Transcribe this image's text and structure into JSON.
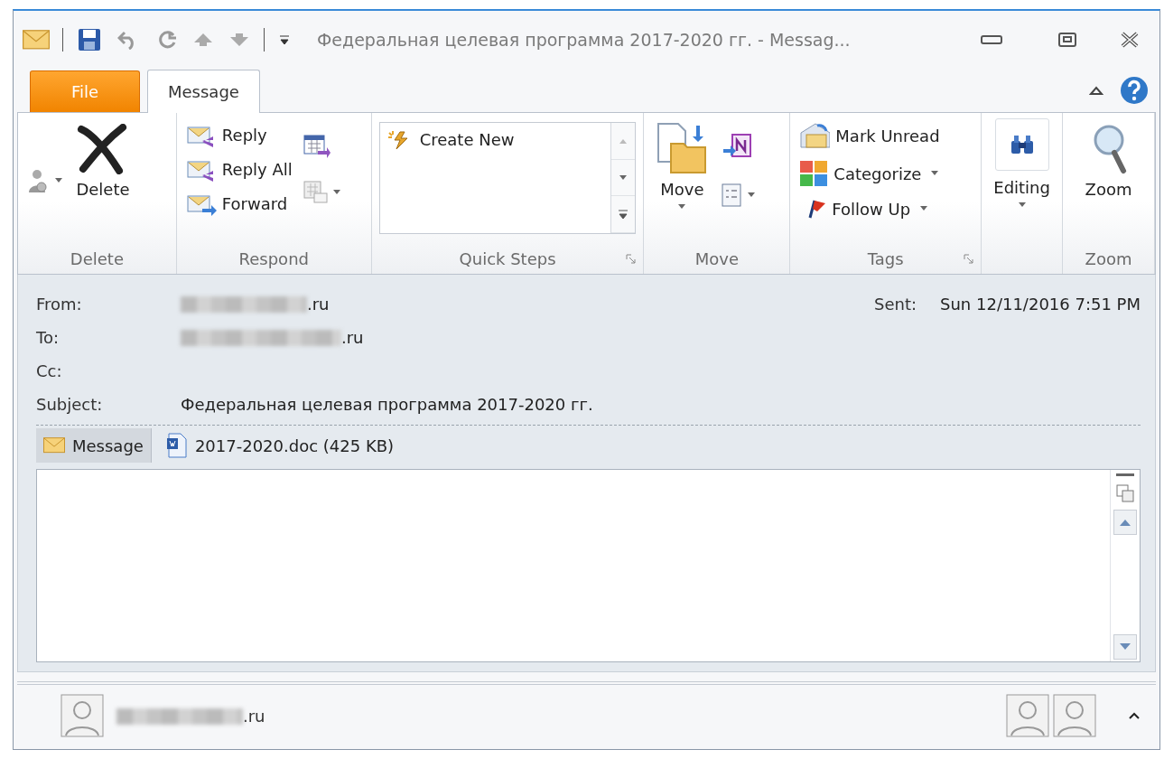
{
  "window": {
    "title": "Федеральная целевая программа 2017-2020 гг.  -  Messag..."
  },
  "tabs": [
    {
      "label": "File",
      "kind": "file",
      "selected": false
    },
    {
      "label": "Message",
      "kind": "tab",
      "selected": true
    }
  ],
  "ribbon": {
    "groups": [
      {
        "label": "Delete",
        "buttons": [
          {
            "label": "Delete"
          }
        ]
      },
      {
        "label": "Respond",
        "buttons": [
          {
            "label": "Reply"
          },
          {
            "label": "Reply All"
          },
          {
            "label": "Forward"
          }
        ]
      },
      {
        "label": "Quick Steps",
        "launcher": true,
        "buttons": [
          {
            "label": "Create New"
          }
        ]
      },
      {
        "label": "Move",
        "buttons": [
          {
            "label": "Move"
          }
        ]
      },
      {
        "label": "Tags",
        "launcher": true,
        "buttons": [
          {
            "label": "Mark Unread"
          },
          {
            "label": "Categorize"
          },
          {
            "label": "Follow Up"
          }
        ]
      },
      {
        "buttons": [
          {
            "label": "Editing"
          }
        ]
      },
      {
        "label": "Zoom",
        "buttons": [
          {
            "label": "Zoom"
          }
        ]
      }
    ]
  },
  "header": {
    "fields": [
      {
        "label": "From:",
        "value": ".ru",
        "redacted": true
      },
      {
        "label": "To:",
        "value": ".ru",
        "redacted": true
      },
      {
        "label": "Cc:",
        "redacted": false
      },
      {
        "label": "Subject:",
        "value": "Федеральная целевая программа 2017-2020 гг.",
        "redacted": false
      }
    ],
    "sent": {
      "label": "Sent:",
      "value": "Sun 12/11/2016 7:51 PM"
    }
  },
  "attachments": [
    {
      "label": "Message",
      "kind": "message",
      "selected": true
    },
    {
      "label": "2017-2020.doc (425 KB)",
      "kind": "file",
      "selected": false
    }
  ],
  "people_pane": {
    "name": ".ru",
    "redacted": true
  }
}
